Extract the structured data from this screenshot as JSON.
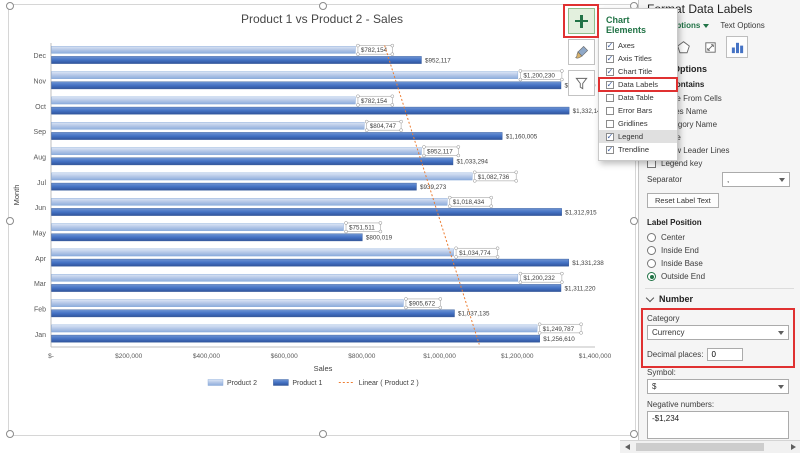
{
  "chart_data": {
    "type": "bar",
    "orientation": "horizontal",
    "title": "Product 1 vs Product 2 - Sales",
    "xlabel": "Sales",
    "ylabel": "Month",
    "categories": [
      "Dec",
      "Nov",
      "Oct",
      "Sep",
      "Aug",
      "Jul",
      "Jun",
      "May",
      "Apr",
      "Mar",
      "Feb",
      "Jan"
    ],
    "series": [
      {
        "name": "Product 2",
        "color": "#b4c7e7",
        "data_labels_selected": true,
        "values": [
          782154,
          1200230,
          782154,
          804747,
          952117,
          1082736,
          1018434,
          751511,
          1034774,
          1200232,
          905672,
          1249787
        ]
      },
      {
        "name": "Product 1",
        "color": "#4472c4",
        "values": [
          952117,
          1311220,
          1332146,
          1160005,
          1033294,
          939273,
          1312915,
          800019,
          1331238,
          1311220,
          1037135,
          1256610
        ]
      }
    ],
    "x_ticks": [
      "$-",
      "$200,000",
      "$400,000",
      "$600,000",
      "$800,000",
      "$1,000,000",
      "$1,200,000",
      "$1,400,000"
    ],
    "x_max": 1400000,
    "number_format": "currency, 0 decimals",
    "legend": [
      {
        "label": "Product 2"
      },
      {
        "label": "Product 1"
      },
      {
        "label": "Linear ( Product 2 )",
        "style": "dotted-line"
      }
    ],
    "trendline": {
      "series": "Product 2",
      "type": "linear",
      "color": "#ed7d31"
    },
    "grid": false,
    "legend_position": "bottom"
  },
  "chart_elements_flyout": {
    "title": "Chart Elements",
    "items": [
      {
        "label": "Axes",
        "checked": true
      },
      {
        "label": "Axis Titles",
        "checked": true
      },
      {
        "label": "Chart Title",
        "checked": true
      },
      {
        "label": "Data Labels",
        "checked": true,
        "red_highlight": true
      },
      {
        "label": "Data Table",
        "checked": false
      },
      {
        "label": "Error Bars",
        "checked": false
      },
      {
        "label": "Gridlines",
        "checked": false
      },
      {
        "label": "Legend",
        "checked": true,
        "hovered": true
      },
      {
        "label": "Trendline",
        "checked": true
      }
    ]
  },
  "format_pane": {
    "title": "Format Data Labels",
    "tabs": [
      {
        "label": "Label Options",
        "active": true
      },
      {
        "label": "Text Options",
        "active": false
      }
    ],
    "icon_tabs": [
      {
        "name": "fill-line"
      },
      {
        "name": "effects"
      },
      {
        "name": "size-properties"
      },
      {
        "name": "label-options",
        "selected": true
      }
    ],
    "section_header": "Label Options",
    "label_contains": {
      "header": "Label Contains",
      "checkboxes": [
        {
          "label": "Value From Cells",
          "checked": false
        },
        {
          "label": "Series Name",
          "checked": false
        },
        {
          "label": "Category Name",
          "checked": false
        },
        {
          "label": "Value",
          "checked": true
        },
        {
          "label": "Show Leader Lines",
          "checked": true
        },
        {
          "label": "Legend key",
          "checked": false
        }
      ],
      "separator_label": "Separator",
      "separator_value": ",",
      "reset_button": "Reset Label Text"
    },
    "label_position": {
      "header": "Label Position",
      "options": [
        {
          "label": "Center",
          "selected": false
        },
        {
          "label": "Inside End",
          "selected": false
        },
        {
          "label": "Inside Base",
          "selected": false
        },
        {
          "label": "Outside End",
          "selected": true
        }
      ]
    },
    "number": {
      "header": "Number",
      "category_label": "Category",
      "category_value": "Currency",
      "decimal_label": "Decimal places:",
      "decimal_value": "0",
      "symbol_label": "Symbol:",
      "symbol_value": "$",
      "negative_label": "Negative numbers:",
      "negative_options": [
        "-$1,234"
      ]
    }
  },
  "colors": {
    "accent_green": "#217346",
    "annotation_red": "#e03131",
    "product1_blue": "#4472c4",
    "product2_blue": "#b4c7e7",
    "trendline_orange": "#ed7d31"
  }
}
